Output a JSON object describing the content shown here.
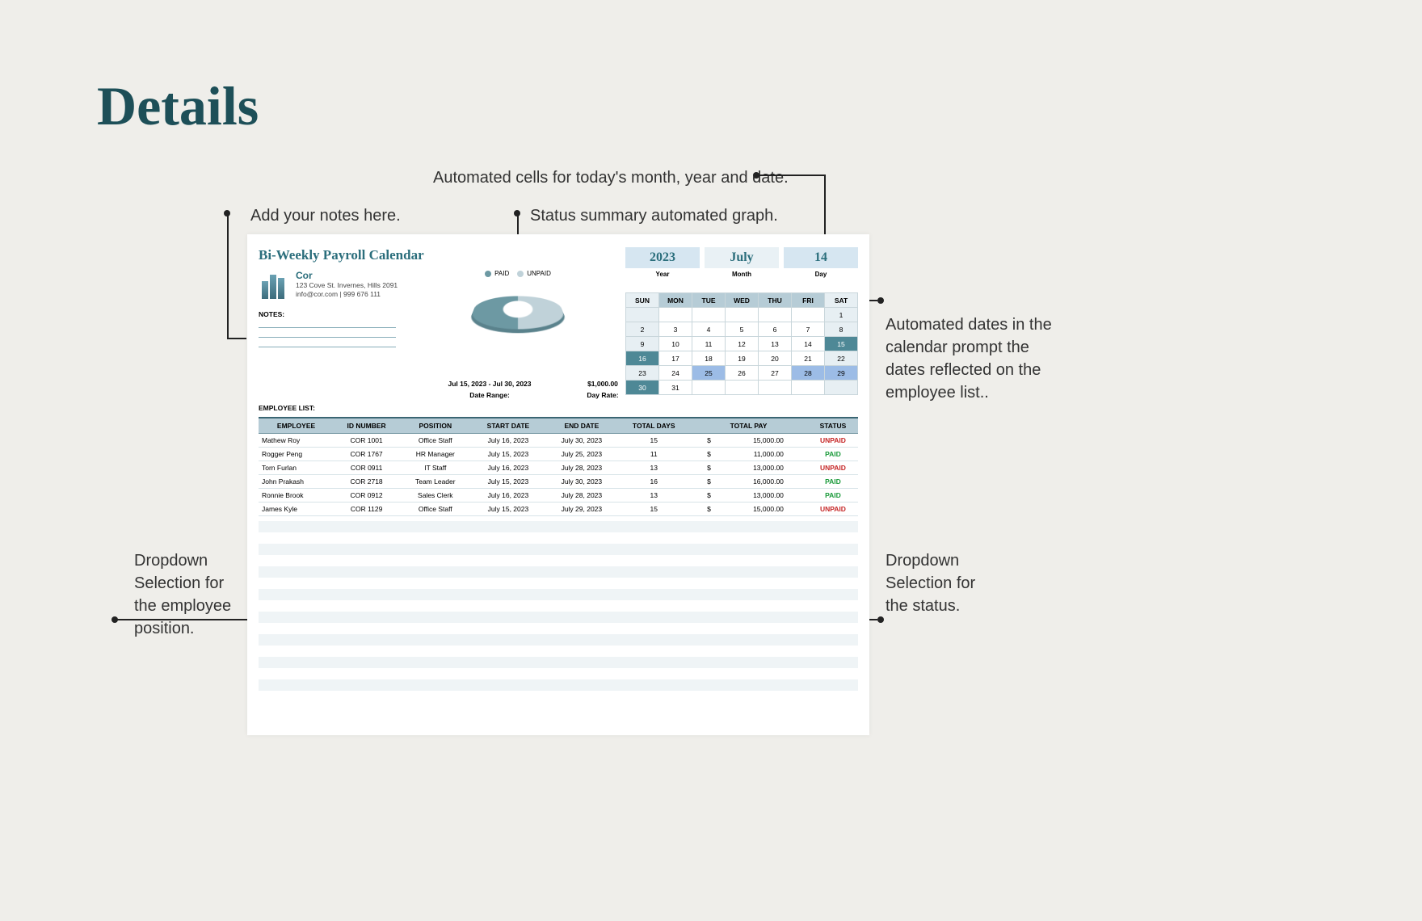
{
  "page_title": "Details",
  "callouts": {
    "notes": "Add your notes here.",
    "graph": "Status summary automated graph.",
    "today": "Automated cells for today's month, year and date.",
    "caldates": "Automated dates in the calendar prompt the dates reflected on the employee list..",
    "dd_position": "Dropdown Selection for the employee position.",
    "dd_status": "Dropdown Selection for the status."
  },
  "doc": {
    "title": "Bi-Weekly Payroll Calendar",
    "company": "Cor",
    "address": "123 Cove St. Invernes, Hills 2091",
    "contact": "info@cor.com | 999 676 111",
    "notes_label": "NOTES:",
    "emp_list_label": "EMPLOYEE LIST:",
    "date_range_val": "Jul 15, 2023 - Jul 30, 2023",
    "date_range_lbl": "Date Range:",
    "day_rate_val": "$1,000.00",
    "day_rate_lbl": "Day Rate:"
  },
  "chart_data": {
    "type": "pie",
    "title": "",
    "series": [
      {
        "name": "PAID",
        "value": 3,
        "color": "#6d99a3"
      },
      {
        "name": "UNPAID",
        "value": 3,
        "color": "#c0d2d9"
      }
    ]
  },
  "date_header": {
    "year": {
      "value": "2023",
      "label": "Year"
    },
    "month": {
      "value": "July",
      "label": "Month"
    },
    "day": {
      "value": "14",
      "label": "Day"
    }
  },
  "calendar": {
    "dow": [
      "SUN",
      "MON",
      "TUE",
      "WED",
      "THU",
      "FRI",
      "SAT"
    ],
    "weeks": [
      [
        {
          "d": ""
        },
        {
          "d": ""
        },
        {
          "d": ""
        },
        {
          "d": ""
        },
        {
          "d": ""
        },
        {
          "d": ""
        },
        {
          "d": "1"
        }
      ],
      [
        {
          "d": "2"
        },
        {
          "d": "3"
        },
        {
          "d": "4"
        },
        {
          "d": "5"
        },
        {
          "d": "6"
        },
        {
          "d": "7"
        },
        {
          "d": "8"
        }
      ],
      [
        {
          "d": "9"
        },
        {
          "d": "10"
        },
        {
          "d": "11"
        },
        {
          "d": "12"
        },
        {
          "d": "13"
        },
        {
          "d": "14"
        },
        {
          "d": "15",
          "hl": "dark"
        }
      ],
      [
        {
          "d": "16",
          "hl": "dark"
        },
        {
          "d": "17"
        },
        {
          "d": "18"
        },
        {
          "d": "19"
        },
        {
          "d": "20"
        },
        {
          "d": "21"
        },
        {
          "d": "22"
        }
      ],
      [
        {
          "d": "23"
        },
        {
          "d": "24"
        },
        {
          "d": "25",
          "hl": "light"
        },
        {
          "d": "26"
        },
        {
          "d": "27"
        },
        {
          "d": "28",
          "hl": "light"
        },
        {
          "d": "29",
          "hl": "light"
        }
      ],
      [
        {
          "d": "30",
          "hl": "dark"
        },
        {
          "d": "31"
        },
        {
          "d": ""
        },
        {
          "d": ""
        },
        {
          "d": ""
        },
        {
          "d": ""
        },
        {
          "d": ""
        }
      ]
    ]
  },
  "table": {
    "headers": [
      "EMPLOYEE",
      "ID NUMBER",
      "POSITION",
      "START DATE",
      "END DATE",
      "TOTAL DAYS",
      "TOTAL PAY",
      "STATUS"
    ],
    "rows": [
      {
        "employee": "Mathew Roy",
        "id": "COR 1001",
        "position": "Office Staff",
        "start": "July 16, 2023",
        "end": "July 30, 2023",
        "days": "15",
        "pay": "15,000.00",
        "status": "UNPAID"
      },
      {
        "employee": "Rogger Peng",
        "id": "COR 1767",
        "position": "HR Manager",
        "start": "July 15, 2023",
        "end": "July 25, 2023",
        "days": "11",
        "pay": "11,000.00",
        "status": "PAID"
      },
      {
        "employee": "Torn Furlan",
        "id": "COR 0911",
        "position": "IT Staff",
        "start": "July 16, 2023",
        "end": "July 28, 2023",
        "days": "13",
        "pay": "13,000.00",
        "status": "UNPAID"
      },
      {
        "employee": "John Prakash",
        "id": "COR 2718",
        "position": "Team Leader",
        "start": "July 15, 2023",
        "end": "July 30, 2023",
        "days": "16",
        "pay": "16,000.00",
        "status": "PAID"
      },
      {
        "employee": "Ronnie Brook",
        "id": "COR 0912",
        "position": "Sales Clerk",
        "start": "July 16, 2023",
        "end": "July 28, 2023",
        "days": "13",
        "pay": "13,000.00",
        "status": "PAID"
      },
      {
        "employee": "James Kyle",
        "id": "COR  1129",
        "position": "Office Staff",
        "start": "July 15, 2023",
        "end": "July 29, 2023",
        "days": "15",
        "pay": "15,000.00",
        "status": "UNPAID"
      }
    ]
  }
}
